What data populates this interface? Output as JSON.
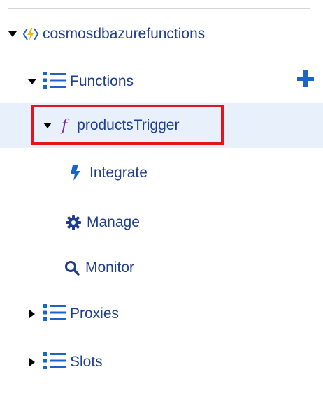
{
  "tree": {
    "app": {
      "label": "cosmosdbazurefunctions",
      "icon": "function-app-icon"
    },
    "functions": {
      "label": "Functions",
      "icon": "list-icon",
      "add_icon": "plus-icon",
      "items": [
        {
          "label": "productsTrigger",
          "icon": "function-icon",
          "selected": true,
          "children": [
            {
              "label": "Integrate",
              "icon": "lightning-icon"
            },
            {
              "label": "Manage",
              "icon": "gear-icon"
            },
            {
              "label": "Monitor",
              "icon": "search-icon"
            }
          ]
        }
      ]
    },
    "proxies": {
      "label": "Proxies",
      "icon": "list-icon"
    },
    "slots": {
      "label": "Slots",
      "icon": "list-icon"
    }
  },
  "colors": {
    "label": "#1e3d8f",
    "accent_blue": "#1b65c7",
    "selection_bg": "#e8f0fb",
    "highlight_border": "#e0151d",
    "function_purple": "#7a2b9a",
    "bolt_yellow": "#f5b800"
  }
}
